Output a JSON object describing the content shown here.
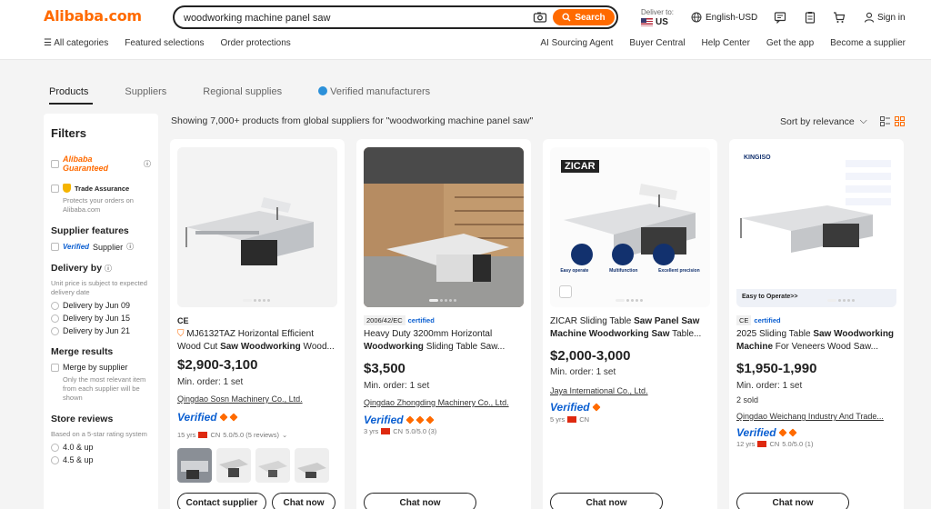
{
  "header": {
    "logo": "Alibaba.com",
    "search_value": "woodworking machine panel saw",
    "search_button": "Search",
    "deliver_label": "Deliver to:",
    "deliver_country": "US",
    "language": "English-USD",
    "signin": "Sign in"
  },
  "subnav_left": [
    "All categories",
    "Featured selections",
    "Order protections"
  ],
  "subnav_right": [
    "AI Sourcing Agent",
    "Buyer Central",
    "Help Center",
    "Get the app",
    "Become a supplier"
  ],
  "tabs": [
    "Products",
    "Suppliers",
    "Regional supplies",
    "Verified manufacturers"
  ],
  "filters": {
    "title": "Filters",
    "alibaba_guaranteed": "Alibaba Guaranteed",
    "trade_assurance": "Trade Assurance",
    "trade_note": "Protects your orders on Alibaba.com",
    "supplier_features": "Supplier features",
    "verified_supplier_v": "Verified",
    "verified_supplier_t": "Supplier",
    "delivery_by": "Delivery by",
    "delivery_note": "Unit price is subject to expected delivery date",
    "delivery_options": [
      "Delivery by Jun 09",
      "Delivery by Jun 15",
      "Delivery by Jun 21"
    ],
    "merge_results": "Merge results",
    "merge_option": "Merge by supplier",
    "merge_note": "Only the most relevant item from each supplier will be shown",
    "store_reviews": "Store reviews",
    "store_note": "Based on a 5-star rating system",
    "rating_options": [
      "4.0 & up",
      "4.5 & up"
    ]
  },
  "results_text": "Showing 7,000+ products from global suppliers for \"woodworking machine panel saw\"",
  "sort_label": "Sort by relevance",
  "products": [
    {
      "badge": "CE",
      "title_pre": "MJ6132TAZ Horizontal Efficient Wood Cut ",
      "title_bold": "Saw Woodworking",
      "title_post": " Wood...",
      "price": "$2,900-3,100",
      "moq": "Min. order: 1 set",
      "supplier": "Qingdao Sosn Machinery Co., Ltd.",
      "verified": "Verified",
      "years": "15 yrs",
      "country": "CN",
      "rating": "5.0/5.0 (5 reviews)",
      "buttons": [
        "Contact supplier",
        "Chat now"
      ]
    },
    {
      "cert_code": "2006/42/EC",
      "cert_label": "certified",
      "title_pre": "Heavy Duty 3200mm Horizontal ",
      "title_bold": "Woodworking",
      "title_post": " Sliding Table Saw...",
      "price": "$3,500",
      "moq": "Min. order: 1 set",
      "supplier": "Qingdao Zhongding Machinery Co., Ltd.",
      "verified": "Verified",
      "years": "3 yrs",
      "country": "CN",
      "rating": "5.0/5.0 (3)",
      "buttons": [
        "Chat now"
      ]
    },
    {
      "img_brand": "ZICAR",
      "img_labels": [
        "Easy operate",
        "Multifunction",
        "Excellent precision"
      ],
      "title_pre": "ZICAR Sliding Table ",
      "title_bold": "Saw Panel Saw Machine Woodworking Saw",
      "title_post": " Table...",
      "price": "$2,000-3,000",
      "moq": "Min. order: 1 set",
      "supplier": "Jaya International Co., Ltd.",
      "verified": "Verified",
      "years": "5 yrs",
      "country": "CN",
      "buttons": [
        "Chat now"
      ]
    },
    {
      "img_brand": "KINGISO",
      "img_caption": "Easy to Operate>>",
      "cert_code": "CE",
      "cert_label": "certified",
      "title_pre": "2025 Sliding Table ",
      "title_bold": "Saw Woodworking Machine",
      "title_post": " For Veneers Wood Saw...",
      "price": "$1,950-1,990",
      "moq": "Min. order: 1 set",
      "sold": "2 sold",
      "supplier": "Qingdao Weichang Industry And Trade...",
      "verified": "Verified",
      "years": "12 yrs",
      "country": "CN",
      "rating": "5.0/5.0 (1)",
      "buttons": [
        "Chat now"
      ]
    }
  ],
  "colors": {
    "brand": "#ff6a00",
    "verified": "#0b5fd1"
  }
}
